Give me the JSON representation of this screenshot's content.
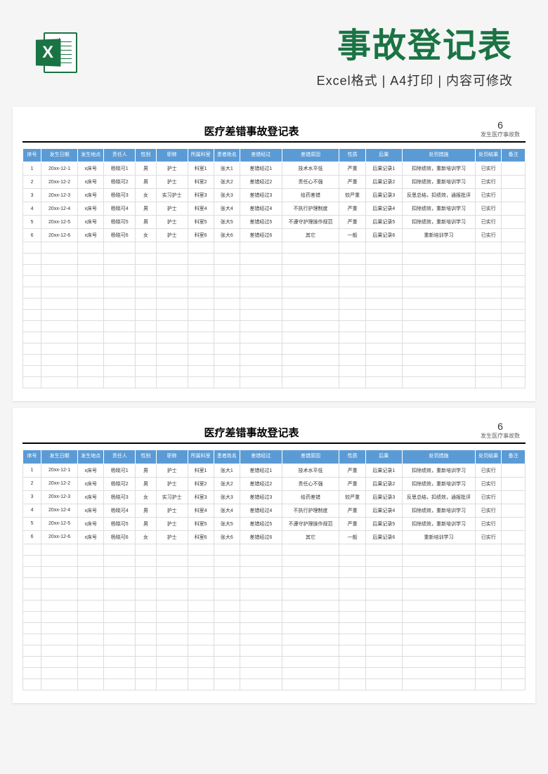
{
  "header": {
    "main_title": "事故登记表",
    "sub_title": "Excel格式 | A4打印 | 内容可修改",
    "icon_letter": "X"
  },
  "sheet": {
    "title": "医疗差错事故登记表",
    "count_number": "6",
    "count_label": "发生医疗事故数"
  },
  "columns": [
    {
      "key": "seq",
      "label": "序号",
      "width": "3.5%"
    },
    {
      "key": "date",
      "label": "发生日期",
      "width": "7%"
    },
    {
      "key": "place",
      "label": "发生地点",
      "width": "5%"
    },
    {
      "key": "person",
      "label": "责任人",
      "width": "6%"
    },
    {
      "key": "gender",
      "label": "性别",
      "width": "4%"
    },
    {
      "key": "title",
      "label": "职称",
      "width": "6%"
    },
    {
      "key": "dept",
      "label": "所属科室",
      "width": "5%"
    },
    {
      "key": "patient",
      "label": "患者姓名",
      "width": "5%"
    },
    {
      "key": "process",
      "label": "差错经过",
      "width": "8%"
    },
    {
      "key": "reason",
      "label": "差错原因",
      "width": "11%"
    },
    {
      "key": "nature",
      "label": "性质",
      "width": "5%"
    },
    {
      "key": "consequence",
      "label": "后果",
      "width": "7%"
    },
    {
      "key": "measure",
      "label": "处罚措施",
      "width": "14%"
    },
    {
      "key": "result",
      "label": "处罚结果",
      "width": "5%"
    },
    {
      "key": "remark",
      "label": "备注",
      "width": "4.5%"
    }
  ],
  "rows": [
    {
      "seq": "1",
      "date": "20xx-12-1",
      "place": "x床号",
      "person": "杨晓可1",
      "gender": "男",
      "title": "护士",
      "dept": "科室1",
      "patient": "张大1",
      "process": "差错经过1",
      "reason": "技术水平低",
      "nature": "严重",
      "consequence": "后果记录1",
      "measure": "扣除绩效，重新培训学习",
      "result": "已实行",
      "remark": ""
    },
    {
      "seq": "2",
      "date": "20xx-12-2",
      "place": "x床号",
      "person": "杨晓可2",
      "gender": "男",
      "title": "护士",
      "dept": "科室2",
      "patient": "张大2",
      "process": "差错经过2",
      "reason": "责任心不强",
      "nature": "严重",
      "consequence": "后果记录2",
      "measure": "扣除绩效，重新培训学习",
      "result": "已实行",
      "remark": ""
    },
    {
      "seq": "3",
      "date": "20xx-12-3",
      "place": "x床号",
      "person": "杨晓可3",
      "gender": "女",
      "title": "实习护士",
      "dept": "科室3",
      "patient": "张大3",
      "process": "差错经过3",
      "reason": "给药差错",
      "nature": "较严重",
      "consequence": "后果记录3",
      "measure": "反思总结，扣绩效，通报批评",
      "result": "已实行",
      "remark": ""
    },
    {
      "seq": "4",
      "date": "20xx-12-4",
      "place": "x床号",
      "person": "杨晓可4",
      "gender": "男",
      "title": "护士",
      "dept": "科室4",
      "patient": "张大4",
      "process": "差错经过4",
      "reason": "不执行护理制度",
      "nature": "严重",
      "consequence": "后果记录4",
      "measure": "扣除绩效，重新培训学习",
      "result": "已实行",
      "remark": ""
    },
    {
      "seq": "5",
      "date": "20xx-12-5",
      "place": "x床号",
      "person": "杨晓可5",
      "gender": "男",
      "title": "护士",
      "dept": "科室5",
      "patient": "张大5",
      "process": "差错经过5",
      "reason": "不遵守护理操作规范",
      "nature": "严重",
      "consequence": "后果记录5",
      "measure": "扣除绩效，重新培训学习",
      "result": "已实行",
      "remark": ""
    },
    {
      "seq": "6",
      "date": "20xx-12-6",
      "place": "x床号",
      "person": "杨晓可6",
      "gender": "女",
      "title": "护士",
      "dept": "科室6",
      "patient": "张大6",
      "process": "差错经过6",
      "reason": "其它",
      "nature": "一般",
      "consequence": "后果记录6",
      "measure": "重新培训学习",
      "result": "已实行",
      "remark": ""
    }
  ],
  "empty_rows": 13
}
